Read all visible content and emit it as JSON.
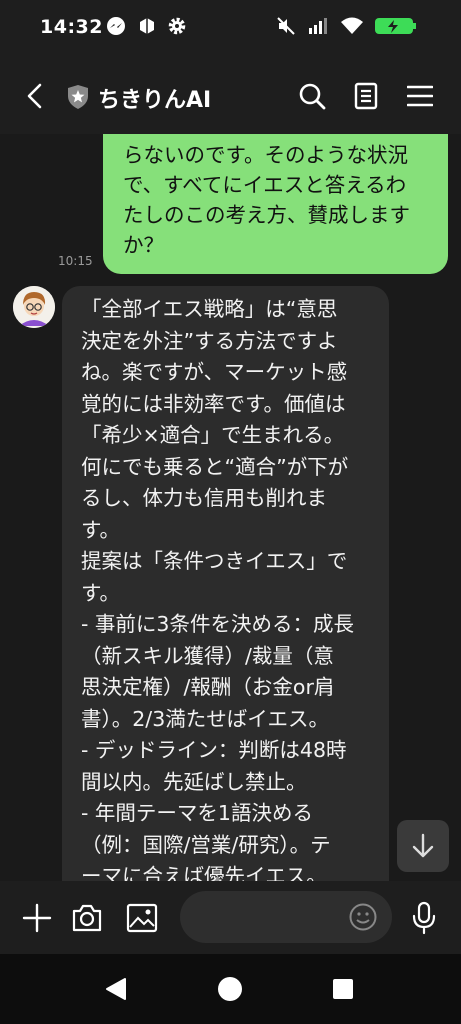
{
  "status_bar": {
    "time": "14:32",
    "icons": [
      "messenger-icon",
      "app-icon",
      "gear-icon",
      "mute-icon",
      "signal-icon",
      "wifi-icon",
      "battery-charging-icon"
    ],
    "battery_color": "#3ddc57"
  },
  "header": {
    "title": "ちきりんAI",
    "back_icon": "chevron-left-icon",
    "badge_icon": "shield-star-icon",
    "actions": [
      "search-icon",
      "notes-icon",
      "menu-icon"
    ]
  },
  "messages": {
    "outgoing": {
      "lines": [
        "らないのです。そのような状況",
        "で、すべてにイエスと答えるわ",
        "たしのこの考え方、賛成します",
        "か？"
      ],
      "time": "10:15",
      "color": "#86e07a"
    },
    "incoming": {
      "lines": [
        "「全部イエス戦略」は“意思",
        "決定を外注”する方法ですよ",
        "ね。楽ですが、マーケット感",
        "覚的には非効率です。価値は",
        "「希少×適合」で生まれる。",
        "何にでも乗ると“適合”が下が",
        "るし、体力も信用も削れま",
        "す。",
        "提案は「条件つきイエス」で",
        "す。",
        "- 事前に3条件を決める：成長",
        "（新スキル獲得）/裁量（意",
        "思決定権）/報酬（お金or肩",
        "書）。2/3満たせばイエス。",
        "- デッドライン：判断は48時",
        "間以内。先延ばし禁止。",
        "- 年間テーマを1語決める",
        "（例：国際/営業/研究）。テ",
        "ーマに合えば優先イエス。"
      ]
    }
  },
  "input_bar": {
    "icons": [
      "plus-icon",
      "camera-icon",
      "image-icon",
      "emoji-icon",
      "microphone-icon"
    ],
    "placeholder": ""
  },
  "nav_bar": {
    "icons": [
      "back-triangle-icon",
      "home-circle-icon",
      "recents-square-icon"
    ]
  }
}
